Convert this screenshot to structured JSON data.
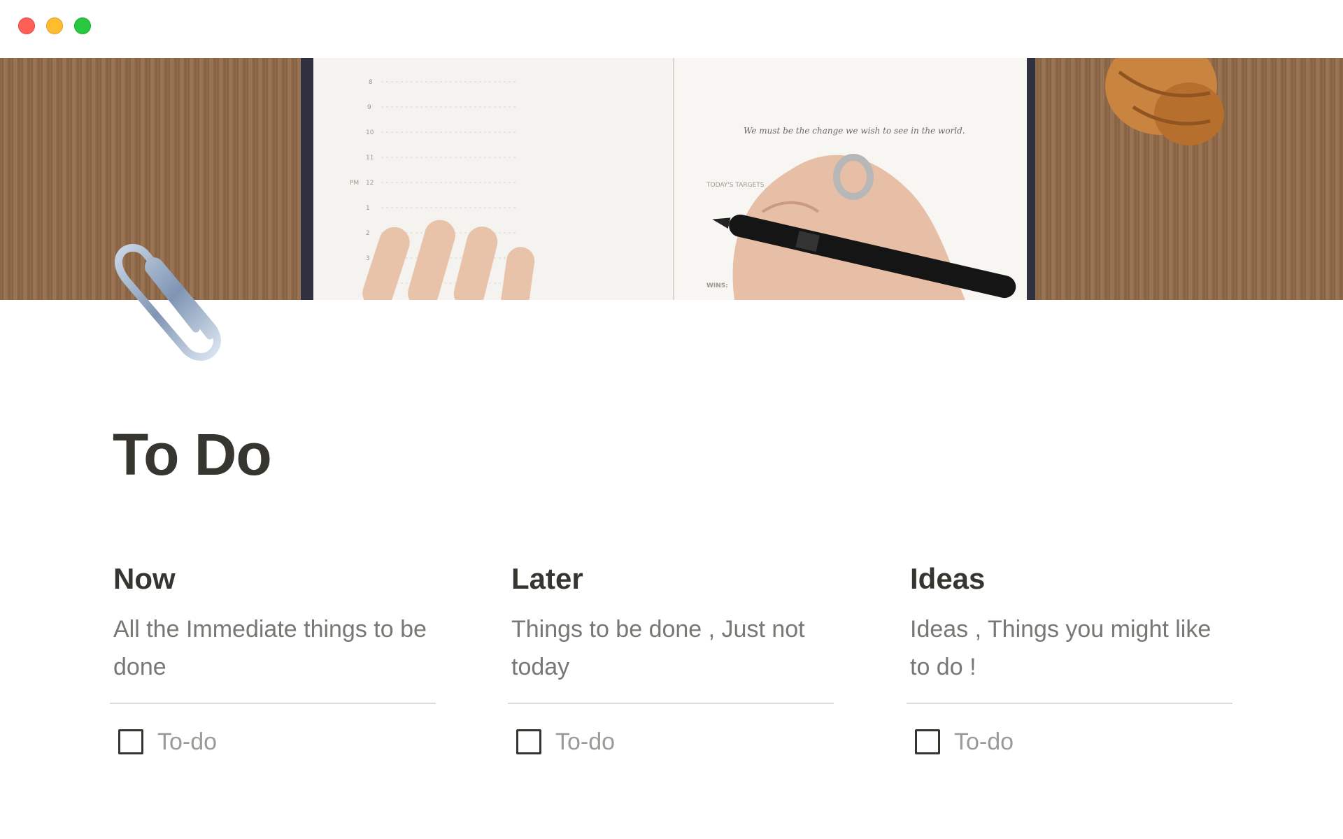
{
  "window": {
    "controls": [
      "close",
      "minimize",
      "maximize"
    ]
  },
  "cover": {
    "quote": "We must be the change we wish to see in the world."
  },
  "page": {
    "icon": "paperclip-icon",
    "title": "To Do"
  },
  "columns": [
    {
      "heading": "Now",
      "description": "All the Immediate things to be done",
      "todo": {
        "label": "To-do",
        "checked": false
      }
    },
    {
      "heading": "Later",
      "description": "Things to be done , Just not today",
      "todo": {
        "label": "To-do",
        "checked": false
      }
    },
    {
      "heading": "Ideas",
      "description": "Ideas , Things you might like to do !",
      "todo": {
        "label": "To-do",
        "checked": false
      }
    }
  ],
  "colors": {
    "text": "#37352f",
    "muted": "#787774",
    "placeholder": "#9b9a97",
    "divider": "#dcdcdb",
    "close": "#ff5f57",
    "minimize": "#febc2e",
    "maximize": "#28c840"
  }
}
